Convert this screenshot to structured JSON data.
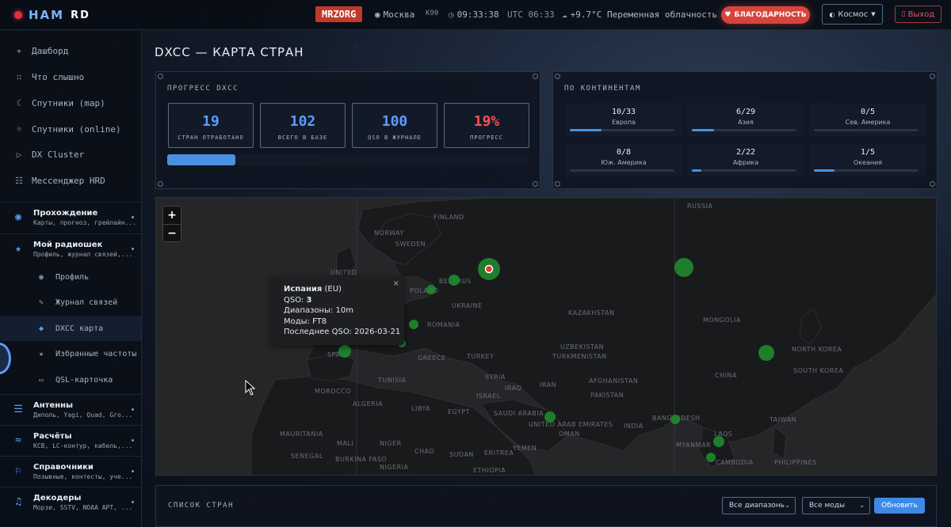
{
  "header": {
    "logo": "HAM",
    "logo_suffix": "RD",
    "callsign": "MRZORG",
    "city": "Москва",
    "locator": "K90",
    "local_time": "09:33:38",
    "utc_time": "UTC 06:33",
    "weather": "+9.7°C Переменная облачность",
    "thanks_label": "БЛАГОДАРНОСТЬ",
    "theme_label": "Космос",
    "exit_label": "Выход"
  },
  "sidebar": {
    "simple": [
      {
        "icon": "plus-icon",
        "label": "Дашборд"
      },
      {
        "icon": "dots-icon",
        "label": "Что слышно"
      },
      {
        "icon": "moon-icon",
        "label": "Спутники (map)"
      },
      {
        "icon": "satellite-icon",
        "label": "Спутники (online)"
      },
      {
        "icon": "play-icon",
        "label": "DX Cluster"
      },
      {
        "icon": "grid-icon",
        "label": "Мессенджер HRD"
      }
    ],
    "groups": [
      {
        "title": "Прохождение",
        "sub": "Карты, прогноз, грейлайн..."
      },
      {
        "title": "Мой радиошек",
        "sub": "Профиль, журнал связей,..."
      },
      {
        "title": "Антенны",
        "sub": "Диполь, Yagi, Quad, Gro..."
      },
      {
        "title": "Расчёты",
        "sub": "КСВ, LC-контур, кабель,..."
      },
      {
        "title": "Справочники",
        "sub": "Позывные, контесты, уче..."
      },
      {
        "title": "Декодеры",
        "sub": "Морзе, SSTV, NOAA APT, ..."
      }
    ],
    "subitems": [
      {
        "label": "Профиль"
      },
      {
        "label": "Журнал связей"
      },
      {
        "label": "DXCC карта"
      },
      {
        "label": "Избранные частоты"
      },
      {
        "label": "QSL-карточка"
      }
    ]
  },
  "page": {
    "title": "DXCC — КАРТА СТРАН"
  },
  "progress_panel": {
    "title": "ПРОГРЕСС DXCC",
    "stats": [
      {
        "value": "19",
        "label": "СТРАН ОТРАБОТАНО"
      },
      {
        "value": "102",
        "label": "ВСЕГО В БАЗЕ"
      },
      {
        "value": "100",
        "label": "QSO В ЖУРНАЛЕ"
      },
      {
        "value": "19%",
        "label": "ПРОГРЕСС"
      }
    ],
    "progress_fraction": 0.19
  },
  "continents_panel": {
    "title": "ПО КОНТИНЕНТАМ",
    "items": [
      {
        "value": "10/33",
        "name": "Европа",
        "fraction": 0.3
      },
      {
        "value": "6/29",
        "name": "Азия",
        "fraction": 0.21
      },
      {
        "value": "0/5",
        "name": "Сев. Америка",
        "fraction": 0
      },
      {
        "value": "0/8",
        "name": "Юж. Америка",
        "fraction": 0
      },
      {
        "value": "2/22",
        "name": "Африка",
        "fraction": 0.09
      },
      {
        "value": "1/5",
        "name": "Океания",
        "fraction": 0.2
      }
    ]
  },
  "map": {
    "zoom_in": "+",
    "zoom_out": "−",
    "labels": [
      "RUSSIA",
      "FINLAND",
      "NORWAY",
      "SWEDEN",
      "BELARUS",
      "POLAND",
      "UKRAINE",
      "ROMANIA",
      "KAZAKHSTAN",
      "MONGOLIA",
      "UZBEKISTAN",
      "TURKMENISTAN",
      "TURKEY",
      "SYRIA",
      "IRAQ",
      "IRAN",
      "AFGHANISTAN",
      "PAKISTAN",
      "CHINA",
      "NORTH KOREA",
      "SOUTH KOREA",
      "INDIA",
      "BANGLADESH",
      "MYANMAR",
      "LAOS",
      "CAMBODIA",
      "TAIWAN",
      "PHILIPPINES",
      "SAUDI ARABIA",
      "UNITED ARAB EMIRATES",
      "OMAN",
      "YEMEN",
      "EGYPT",
      "LIBYA",
      "TUNISIA",
      "ALGERIA",
      "MOROCCO",
      "MAURITANIA",
      "MALI",
      "NIGER",
      "CHAD",
      "SUDAN",
      "ERITREA",
      "ETHIOPIA",
      "SENEGAL",
      "BURKINA FASO",
      "NIGERIA",
      "GREECE",
      "SPAIN",
      "UNITED",
      "ISRAEL"
    ],
    "popup": {
      "country": "Испания",
      "continent": "(EU)",
      "qso_label": "QSO:",
      "qso_value": "3",
      "bands": "Диапазоны: 10m",
      "modes": "Моды: FT8",
      "last_qso": "Последнее QSO: 2026-03-21",
      "close": "×"
    }
  },
  "country_list": {
    "title": "СПИСОК СТРАН",
    "band_select": "Все диапазоны",
    "mode_select": "Все моды",
    "refresh_label": "Обновить"
  },
  "colors": {
    "accent": "#4a90e2",
    "danger": "#d8443c",
    "worked": "#1f8a2e"
  }
}
